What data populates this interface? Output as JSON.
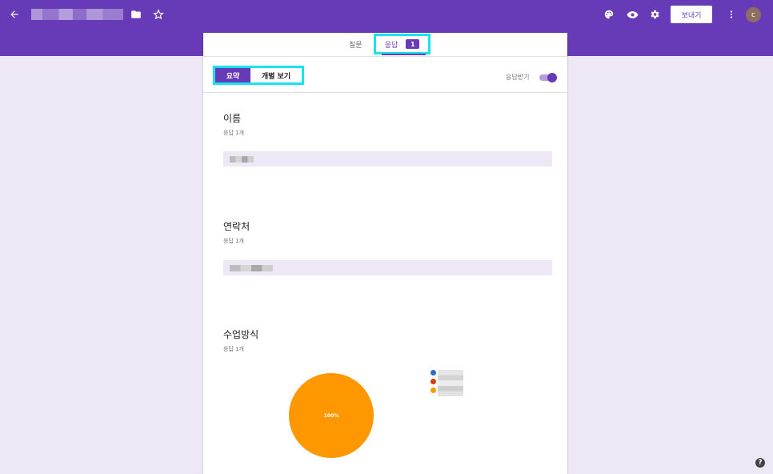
{
  "header": {
    "send_label": "보내기",
    "avatar_initial": "c"
  },
  "tabs": {
    "questions_label": "질문",
    "responses_label": "응답",
    "responses_count": "1"
  },
  "toolbar": {
    "summary_label": "요약",
    "individual_label": "개별 보기",
    "accepting_label": "응답받기",
    "accepting_on": true
  },
  "questions": [
    {
      "title": "이름",
      "count_label": "응답 1개"
    },
    {
      "title": "연락처",
      "count_label": "응답 1개"
    },
    {
      "title": "수업방식",
      "count_label": "응답 1개"
    }
  ],
  "chart_data": {
    "type": "pie",
    "slices": [
      {
        "value": 100,
        "label": "100%",
        "color": "#ff9800"
      }
    ],
    "legend_colors": [
      "#3366cc",
      "#dc3912",
      "#ff9800"
    ]
  },
  "colors": {
    "brand": "#673ab7",
    "highlight": "#19e3f0",
    "background": "#ede7f6"
  },
  "help_label": "?"
}
